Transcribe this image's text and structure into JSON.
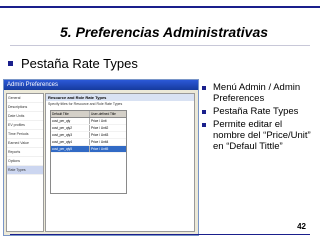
{
  "slide": {
    "title": "5. Preferencias Administrativas",
    "main_bullet": "Pestaña Rate Types",
    "page_number": "42",
    "accent_color": "#1a1f8c"
  },
  "dialog": {
    "title": "Admin Preferences",
    "nav_items": [
      "General",
      "Descriptions",
      "Date Units",
      "EV profiles",
      "Time Periods",
      "Earned Value",
      "Reports",
      "Options",
      "Rate Types"
    ],
    "selected_nav": "Rate Types",
    "panel_heading": "Resource and Role Rate Types",
    "panel_subtitle": "Specify titles for Resource and Role Rate Types",
    "grid": {
      "headers": [
        "Default Title",
        "User-defined Title"
      ],
      "rows": [
        [
          "cost_per_qty",
          "Price / Unit"
        ],
        [
          "cost_per_qty2",
          "Price / Unit2"
        ],
        [
          "cost_per_qty3",
          "Price / Unit3"
        ],
        [
          "cost_per_qty4",
          "Price / Unit4"
        ],
        [
          "cost_per_qty5",
          "Price / Unit5"
        ]
      ]
    }
  },
  "notes": [
    "Menú Admin / Admin Preferences",
    "Pestaña Rate Types",
    "Permite editar el nombre del “Price/Unit” en “Defaul Tittle”"
  ]
}
